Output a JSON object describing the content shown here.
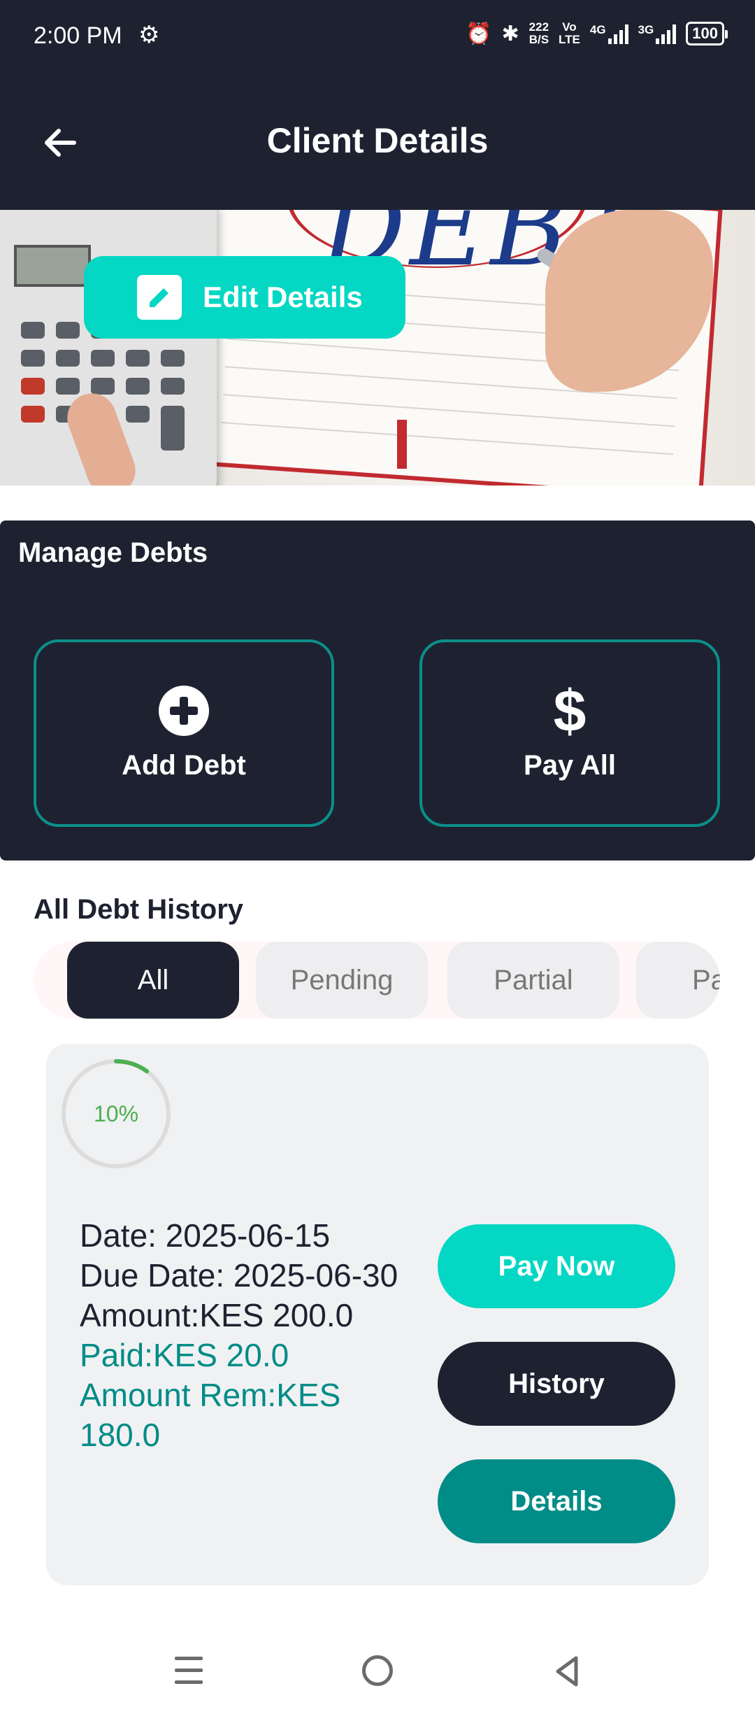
{
  "status_bar": {
    "time": "2:00 PM",
    "net_speed_value": "222",
    "net_speed_unit": "B/S",
    "vo": "Vo",
    "lte": "LTE",
    "sim1_label": "4G",
    "sim2_label": "3G",
    "battery": "100"
  },
  "header": {
    "title": "Client Details"
  },
  "hero": {
    "image_text": "DEBT",
    "edit_button_label": "Edit Details"
  },
  "manage": {
    "title": "Manage Debts",
    "add_debt_label": "Add Debt",
    "pay_all_label": "Pay All",
    "dollar_glyph": "$"
  },
  "history": {
    "title": "All Debt History",
    "filters": [
      {
        "label": "All",
        "selected": true
      },
      {
        "label": "Pending",
        "selected": false
      },
      {
        "label": "Partial",
        "selected": false
      },
      {
        "label": "Pa",
        "selected": false
      }
    ],
    "card": {
      "progress_percent": 10,
      "progress_label": "10%",
      "date": "Date: 2025-06-15",
      "due_date": "Due Date: 2025-06-30",
      "amount": "Amount:KES 200.0",
      "paid": "Paid:KES 20.0",
      "remaining_line1": "Amount Rem:KES",
      "remaining_line2": "180.0",
      "pay_now_label": "Pay Now",
      "history_label": "History",
      "details_label": "Details"
    }
  },
  "colors": {
    "dark": "#1e2230",
    "accent": "#04d7c3",
    "teal": "#008c87",
    "progress": "#4caf50"
  }
}
